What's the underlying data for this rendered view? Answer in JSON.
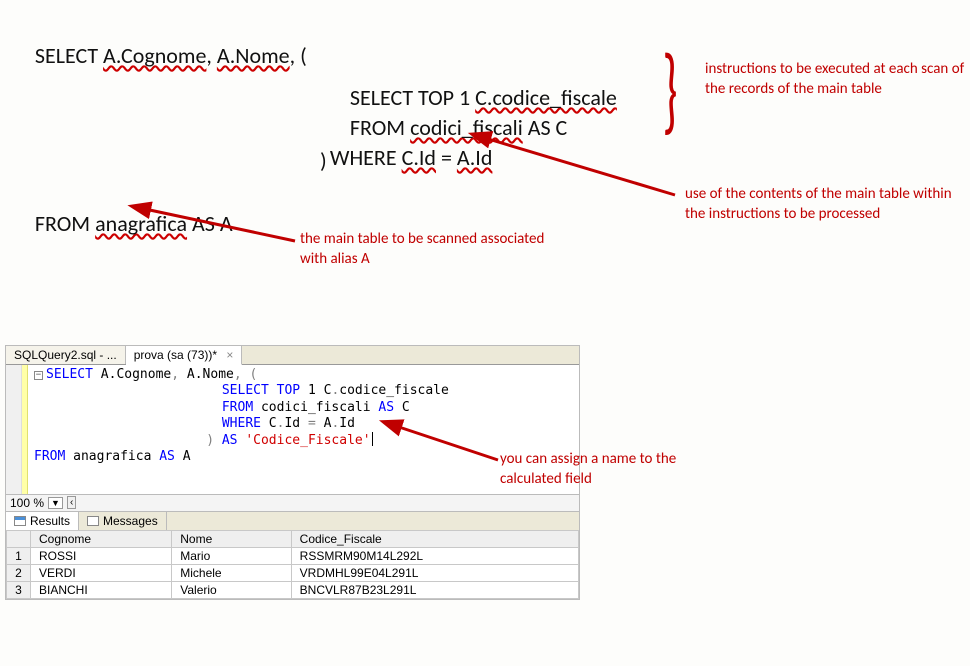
{
  "diagram": {
    "line1_prefix": "SELECT ",
    "line1_cognome": "A.Cognome",
    "line1_sep1": ", ",
    "line1_nome": "A.Nome",
    "line1_suffix": ", (",
    "line2": "SELECT TOP 1 ",
    "line2_col": "C.codice_fiscale",
    "line3": "FROM ",
    "line3_tbl": "codici_fiscali",
    "line3_as": " AS C",
    "line4": "WHERE ",
    "line4_l": "C.Id",
    "line4_eq": " = ",
    "line4_r": "A.Id",
    "line5": ")",
    "line6_from": "FROM ",
    "line6_tbl": "anagrafica",
    "line6_as": " AS A"
  },
  "annotations": {
    "right1": "instructions to be executed at each scan of the records of the main table",
    "right2": "use of the contents of the main table within the instructions to be processed",
    "bottom1": "the main table to be scanned associated with alias A",
    "ide_note": "you can assign a name to the calculated field"
  },
  "brace": "}",
  "ide": {
    "tabs": {
      "file": "SQLQuery2.sql - ...",
      "conn": "prova (sa (73))*",
      "close": "×"
    },
    "code": {
      "l1a": "SELECT",
      "l1b": " A.Cognome",
      "l1c": ",",
      "l1d": " A.Nome",
      "l1e": ",",
      "l1f": " ",
      "l1g": "(",
      "l2a": "SELECT",
      "l2b": " ",
      "l2c": "TOP",
      "l2d": " 1 C",
      "l2e": ".",
      "l2f": "codice_fiscale",
      "l3a": "FROM",
      "l3b": " codici_fiscali ",
      "l3c": "AS",
      "l3d": " C",
      "l4a": "WHERE",
      "l4b": " C",
      "l4c": ".",
      "l4d": "Id ",
      "l4e": "=",
      "l4f": " A",
      "l4g": ".",
      "l4h": "Id",
      "l5a": ")",
      "l5b": " ",
      "l5c": "AS",
      "l5d": " ",
      "l5e": "'Codice_Fiscale'",
      "l6a": "FROM",
      "l6b": " anagrafica ",
      "l6c": "AS",
      "l6d": " A",
      "boxminus": "−"
    },
    "zoom": {
      "value": "100 %",
      "drop": "▼",
      "scroll": "‹"
    },
    "result_tabs": {
      "results": "Results",
      "messages": "Messages"
    },
    "grid": {
      "headers": [
        "",
        "Cognome",
        "Nome",
        "Codice_Fiscale"
      ],
      "rows": [
        {
          "n": "1",
          "cognome": "ROSSI",
          "nome": "Mario",
          "cf": "RSSMRM90M14L292L"
        },
        {
          "n": "2",
          "cognome": "VERDI",
          "nome": "Michele",
          "cf": "VRDMHL99E04L291L"
        },
        {
          "n": "3",
          "cognome": "BIANCHI",
          "nome": "Valerio",
          "cf": "BNCVLR87B23L291L"
        }
      ]
    }
  },
  "chart_data": {
    "type": "table",
    "title": "Correlated subquery result set",
    "columns": [
      "Cognome",
      "Nome",
      "Codice_Fiscale"
    ],
    "rows": [
      [
        "ROSSI",
        "Mario",
        "RSSMRM90M14L292L"
      ],
      [
        "VERDI",
        "Michele",
        "VRDMHL99E04L291L"
      ],
      [
        "BIANCHI",
        "Valerio",
        "BNCVLR87B23L291L"
      ]
    ]
  }
}
